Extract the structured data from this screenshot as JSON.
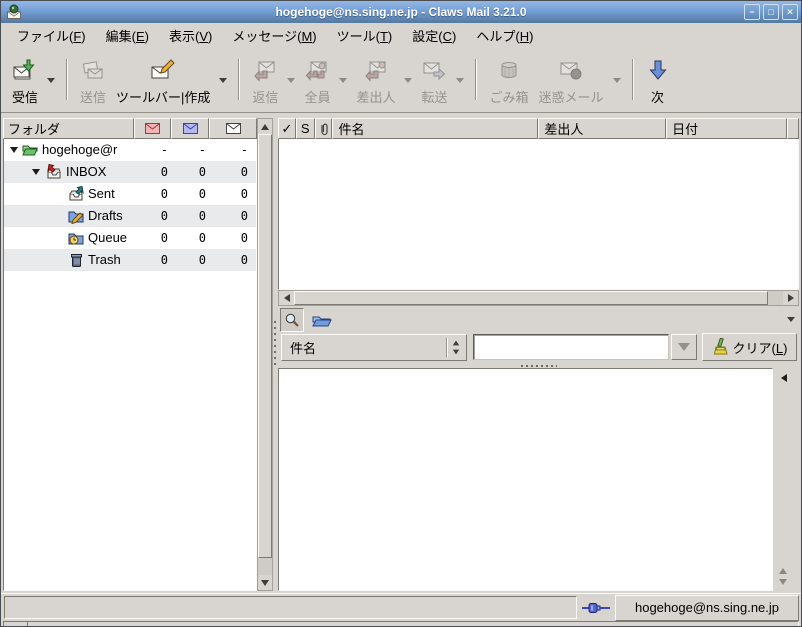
{
  "window": {
    "title": "hogehoge@ns.sing.ne.jp - Claws Mail 3.21.0",
    "controls": {
      "minimize": "−",
      "maximize": "□",
      "close": "✕"
    }
  },
  "menubar": [
    {
      "pre": "ファイル(",
      "key": "F",
      "post": ")"
    },
    {
      "pre": "編集(",
      "key": "E",
      "post": ")"
    },
    {
      "pre": "表示(",
      "key": "V",
      "post": ")"
    },
    {
      "pre": "メッセージ(",
      "key": "M",
      "post": ")"
    },
    {
      "pre": "ツール(",
      "key": "T",
      "post": ")"
    },
    {
      "pre": "設定(",
      "key": "C",
      "post": ")"
    },
    {
      "pre": "ヘルプ(",
      "key": "H",
      "post": ")"
    }
  ],
  "toolbar": {
    "receive": "受信",
    "send": "送信",
    "compose": "ツールバー|作成",
    "reply": "返信",
    "reply_all": "全員",
    "reply_sender": "差出人",
    "forward": "転送",
    "trash": "ごみ箱",
    "spam": "迷惑メール",
    "next": "次"
  },
  "folder_pane": {
    "header_label": "フォルダ",
    "column_icons": [
      "new-mail-icon",
      "unread-mail-icon",
      "total-mail-icon"
    ],
    "rows": [
      {
        "label": "hogehoge@r",
        "new": "-",
        "unread": "-",
        "total": "-"
      },
      {
        "label": "INBOX",
        "new": "0",
        "unread": "0",
        "total": "0"
      },
      {
        "label": "Sent",
        "new": "0",
        "unread": "0",
        "total": "0"
      },
      {
        "label": "Drafts",
        "new": "0",
        "unread": "0",
        "total": "0"
      },
      {
        "label": "Queue",
        "new": "0",
        "unread": "0",
        "total": "0"
      },
      {
        "label": "Trash",
        "new": "0",
        "unread": "0",
        "total": "0"
      }
    ]
  },
  "message_list": {
    "columns": {
      "marked": "✓",
      "status": "S",
      "subject": "件名",
      "from": "差出人",
      "date": "日付"
    },
    "rows": []
  },
  "quick_search": {
    "criteria_value": "件名",
    "entry_value": "",
    "clear_button": {
      "pre": "クリア(",
      "key": "L",
      "post": ")"
    }
  },
  "statusbar": {
    "account_selector": "hogehoge@ns.sing.ne.jp"
  },
  "colors": {
    "titlebar_top": "#93b7e4",
    "titlebar_bottom": "#54799f",
    "chrome_bg": "#d8d4cf",
    "row_stripe": "#e9eaec",
    "disabled_text": "#96938c"
  }
}
